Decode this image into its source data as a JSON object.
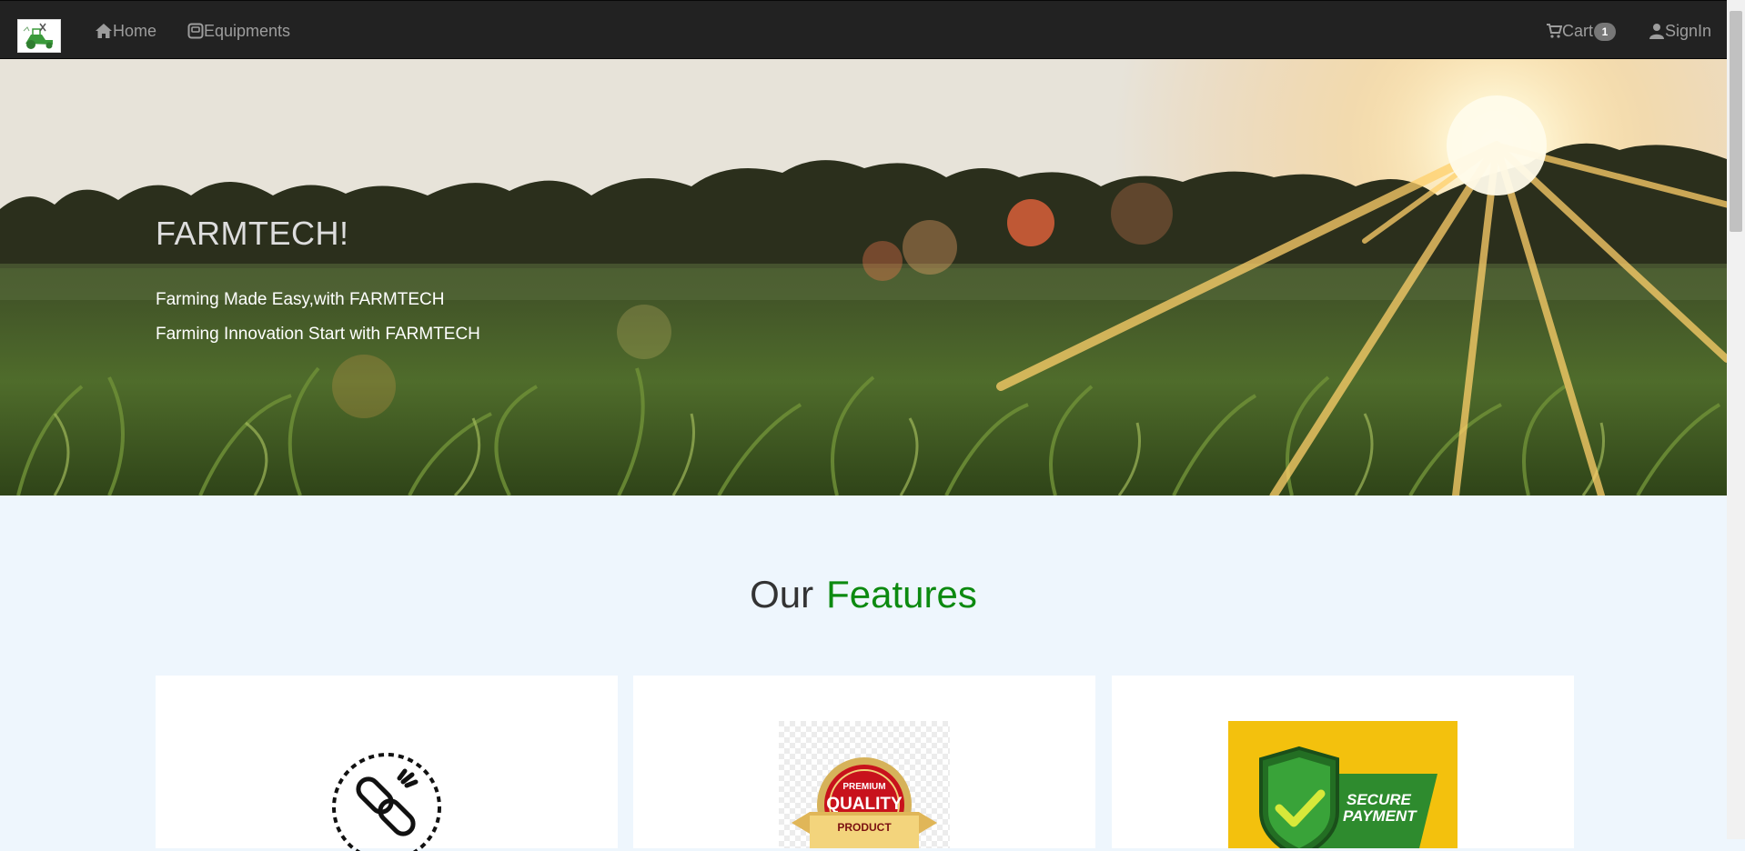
{
  "navbar": {
    "logo_icon": "tractor-logo-icon",
    "home_label": "Home",
    "home_icon": "home-icon",
    "equipments_label": "Equipments",
    "equipments_icon": "equipment-box-icon",
    "cart_label": "Cart",
    "cart_icon": "cart-icon",
    "cart_count": "1",
    "signin_label": "SignIn",
    "signin_icon": "user-icon"
  },
  "hero": {
    "title": "FARMTECH!",
    "line1": "Farming Made Easy,with FARMTECH",
    "line2": "Farming Innovation Start with FARMTECH"
  },
  "features": {
    "heading_prefix": "Our",
    "heading_accent": "Features",
    "accent_color": "#0c8a10",
    "cards": [
      {
        "icon": "link-chain-icon"
      },
      {
        "icon": "premium-quality-badge-icon",
        "badge_top": "PREMIUM",
        "badge_main": "QUALITY",
        "badge_ribbon": "PRODUCT"
      },
      {
        "icon": "secure-payment-shield-icon",
        "text_line1": "SECURE",
        "text_line2": "PAYMENT"
      }
    ]
  }
}
